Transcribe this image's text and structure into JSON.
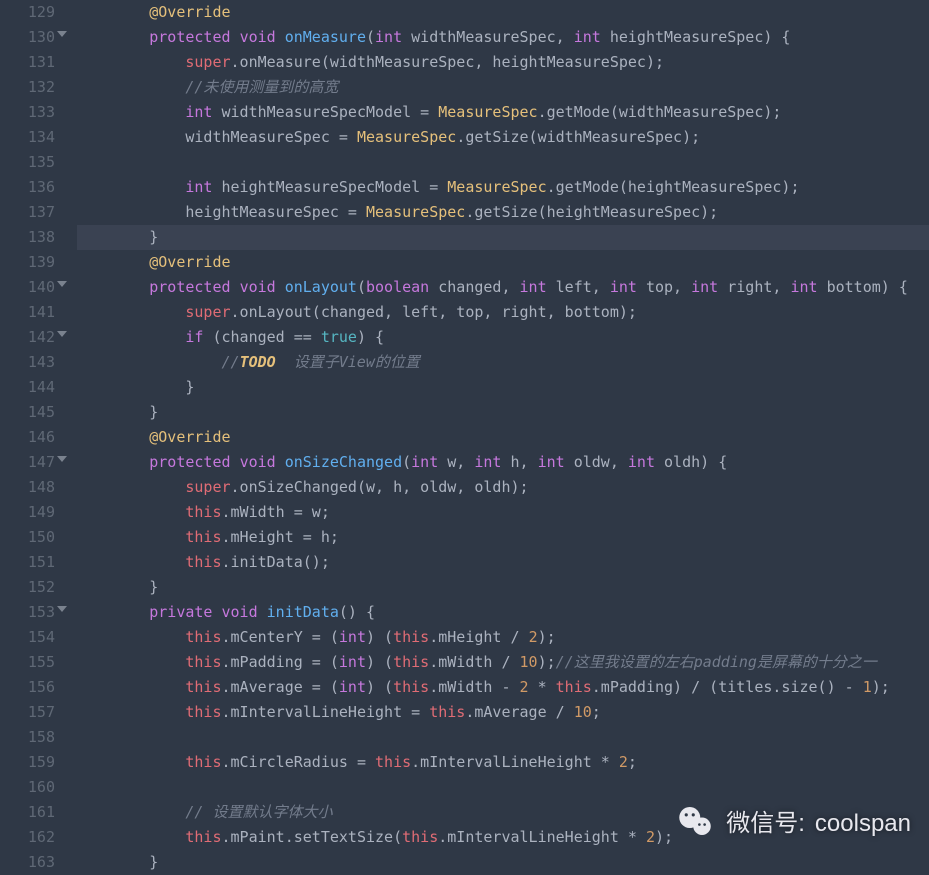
{
  "lines": [
    {
      "n": 129,
      "fold": false,
      "hl": false,
      "tokens": [
        [
          "pn",
          "        "
        ],
        [
          "ann",
          "@Override"
        ]
      ]
    },
    {
      "n": 130,
      "fold": true,
      "hl": false,
      "tokens": [
        [
          "pn",
          "        "
        ],
        [
          "kw",
          "protected"
        ],
        [
          "pn",
          " "
        ],
        [
          "kw",
          "void"
        ],
        [
          "pn",
          " "
        ],
        [
          "fn",
          "onMeasure"
        ],
        [
          "pn",
          "("
        ],
        [
          "kw",
          "int"
        ],
        [
          "pn",
          " widthMeasureSpec, "
        ],
        [
          "kw",
          "int"
        ],
        [
          "pn",
          " heightMeasureSpec) {"
        ]
      ]
    },
    {
      "n": 131,
      "fold": false,
      "hl": false,
      "tokens": [
        [
          "pn",
          "            "
        ],
        [
          "sup",
          "super"
        ],
        [
          "pn",
          ".onMeasure(widthMeasureSpec, heightMeasureSpec);"
        ]
      ]
    },
    {
      "n": 132,
      "fold": false,
      "hl": false,
      "tokens": [
        [
          "pn",
          "            "
        ],
        [
          "com",
          "//未使用测量到的高宽"
        ]
      ]
    },
    {
      "n": 133,
      "fold": false,
      "hl": false,
      "tokens": [
        [
          "pn",
          "            "
        ],
        [
          "kw",
          "int"
        ],
        [
          "pn",
          " widthMeasureSpecModel = "
        ],
        [
          "kw2",
          "MeasureSpec"
        ],
        [
          "pn",
          ".getMode(widthMeasureSpec);"
        ]
      ]
    },
    {
      "n": 134,
      "fold": false,
      "hl": false,
      "tokens": [
        [
          "pn",
          "            widthMeasureSpec = "
        ],
        [
          "kw2",
          "MeasureSpec"
        ],
        [
          "pn",
          ".getSize(widthMeasureSpec);"
        ]
      ]
    },
    {
      "n": 135,
      "fold": false,
      "hl": false,
      "tokens": [
        [
          "pn",
          ""
        ]
      ]
    },
    {
      "n": 136,
      "fold": false,
      "hl": false,
      "tokens": [
        [
          "pn",
          "            "
        ],
        [
          "kw",
          "int"
        ],
        [
          "pn",
          " heightMeasureSpecModel = "
        ],
        [
          "kw2",
          "MeasureSpec"
        ],
        [
          "pn",
          ".getMode(heightMeasureSpec);"
        ]
      ]
    },
    {
      "n": 137,
      "fold": false,
      "hl": false,
      "tokens": [
        [
          "pn",
          "            heightMeasureSpec = "
        ],
        [
          "kw2",
          "MeasureSpec"
        ],
        [
          "pn",
          ".getSize(heightMeasureSpec);"
        ]
      ]
    },
    {
      "n": 138,
      "fold": false,
      "hl": true,
      "tokens": [
        [
          "pn",
          "        }"
        ]
      ]
    },
    {
      "n": 139,
      "fold": false,
      "hl": false,
      "tokens": [
        [
          "pn",
          "        "
        ],
        [
          "ann",
          "@Override"
        ]
      ]
    },
    {
      "n": 140,
      "fold": true,
      "hl": false,
      "tokens": [
        [
          "pn",
          "        "
        ],
        [
          "kw",
          "protected"
        ],
        [
          "pn",
          " "
        ],
        [
          "kw",
          "void"
        ],
        [
          "pn",
          " "
        ],
        [
          "fn",
          "onLayout"
        ],
        [
          "pn",
          "("
        ],
        [
          "kw",
          "boolean"
        ],
        [
          "pn",
          " changed, "
        ],
        [
          "kw",
          "int"
        ],
        [
          "pn",
          " left, "
        ],
        [
          "kw",
          "int"
        ],
        [
          "pn",
          " top, "
        ],
        [
          "kw",
          "int"
        ],
        [
          "pn",
          " right, "
        ],
        [
          "kw",
          "int"
        ],
        [
          "pn",
          " bottom) {"
        ]
      ]
    },
    {
      "n": 141,
      "fold": false,
      "hl": false,
      "tokens": [
        [
          "pn",
          "            "
        ],
        [
          "sup",
          "super"
        ],
        [
          "pn",
          ".onLayout(changed, left, top, right, bottom);"
        ]
      ]
    },
    {
      "n": 142,
      "fold": true,
      "hl": false,
      "tokens": [
        [
          "pn",
          "            "
        ],
        [
          "kw",
          "if"
        ],
        [
          "pn",
          " (changed == "
        ],
        [
          "lit",
          "true"
        ],
        [
          "pn",
          ") {"
        ]
      ]
    },
    {
      "n": 143,
      "fold": false,
      "hl": false,
      "tokens": [
        [
          "pn",
          "                "
        ],
        [
          "com",
          "//"
        ],
        [
          "todo",
          "TODO"
        ],
        [
          "com",
          "  设置子View的位置"
        ]
      ]
    },
    {
      "n": 144,
      "fold": false,
      "hl": false,
      "tokens": [
        [
          "pn",
          "            }"
        ]
      ]
    },
    {
      "n": 145,
      "fold": false,
      "hl": false,
      "tokens": [
        [
          "pn",
          "        }"
        ]
      ]
    },
    {
      "n": 146,
      "fold": false,
      "hl": false,
      "tokens": [
        [
          "pn",
          "        "
        ],
        [
          "ann",
          "@Override"
        ]
      ]
    },
    {
      "n": 147,
      "fold": true,
      "hl": false,
      "tokens": [
        [
          "pn",
          "        "
        ],
        [
          "kw",
          "protected"
        ],
        [
          "pn",
          " "
        ],
        [
          "kw",
          "void"
        ],
        [
          "pn",
          " "
        ],
        [
          "fn",
          "onSizeChanged"
        ],
        [
          "pn",
          "("
        ],
        [
          "kw",
          "int"
        ],
        [
          "pn",
          " w, "
        ],
        [
          "kw",
          "int"
        ],
        [
          "pn",
          " h, "
        ],
        [
          "kw",
          "int"
        ],
        [
          "pn",
          " oldw, "
        ],
        [
          "kw",
          "int"
        ],
        [
          "pn",
          " oldh) {"
        ]
      ]
    },
    {
      "n": 148,
      "fold": false,
      "hl": false,
      "tokens": [
        [
          "pn",
          "            "
        ],
        [
          "sup",
          "super"
        ],
        [
          "pn",
          ".onSizeChanged(w, h, oldw, oldh);"
        ]
      ]
    },
    {
      "n": 149,
      "fold": false,
      "hl": false,
      "tokens": [
        [
          "pn",
          "            "
        ],
        [
          "sup",
          "this"
        ],
        [
          "pn",
          ".mWidth = w;"
        ]
      ]
    },
    {
      "n": 150,
      "fold": false,
      "hl": false,
      "tokens": [
        [
          "pn",
          "            "
        ],
        [
          "sup",
          "this"
        ],
        [
          "pn",
          ".mHeight = h;"
        ]
      ]
    },
    {
      "n": 151,
      "fold": false,
      "hl": false,
      "tokens": [
        [
          "pn",
          "            "
        ],
        [
          "sup",
          "this"
        ],
        [
          "pn",
          ".initData();"
        ]
      ]
    },
    {
      "n": 152,
      "fold": false,
      "hl": false,
      "tokens": [
        [
          "pn",
          "        }"
        ]
      ]
    },
    {
      "n": 153,
      "fold": true,
      "hl": false,
      "tokens": [
        [
          "pn",
          "        "
        ],
        [
          "kw",
          "private"
        ],
        [
          "pn",
          " "
        ],
        [
          "kw",
          "void"
        ],
        [
          "pn",
          " "
        ],
        [
          "fn",
          "initData"
        ],
        [
          "pn",
          "() {"
        ]
      ]
    },
    {
      "n": 154,
      "fold": false,
      "hl": false,
      "tokens": [
        [
          "pn",
          "            "
        ],
        [
          "sup",
          "this"
        ],
        [
          "pn",
          ".mCenterY = ("
        ],
        [
          "kw",
          "int"
        ],
        [
          "pn",
          ") ("
        ],
        [
          "sup",
          "this"
        ],
        [
          "pn",
          ".mHeight / "
        ],
        [
          "num",
          "2"
        ],
        [
          "pn",
          ");"
        ]
      ]
    },
    {
      "n": 155,
      "fold": false,
      "hl": false,
      "tokens": [
        [
          "pn",
          "            "
        ],
        [
          "sup",
          "this"
        ],
        [
          "pn",
          ".mPadding = ("
        ],
        [
          "kw",
          "int"
        ],
        [
          "pn",
          ") ("
        ],
        [
          "sup",
          "this"
        ],
        [
          "pn",
          ".mWidth / "
        ],
        [
          "num",
          "10"
        ],
        [
          "pn",
          ");"
        ],
        [
          "com",
          "//这里我设置的左右padding是屏幕的十分之一"
        ]
      ]
    },
    {
      "n": 156,
      "fold": false,
      "hl": false,
      "tokens": [
        [
          "pn",
          "            "
        ],
        [
          "sup",
          "this"
        ],
        [
          "pn",
          ".mAverage = ("
        ],
        [
          "kw",
          "int"
        ],
        [
          "pn",
          ") ("
        ],
        [
          "sup",
          "this"
        ],
        [
          "pn",
          ".mWidth - "
        ],
        [
          "num",
          "2"
        ],
        [
          "pn",
          " * "
        ],
        [
          "sup",
          "this"
        ],
        [
          "pn",
          ".mPadding) / (titles.size() - "
        ],
        [
          "num",
          "1"
        ],
        [
          "pn",
          ");"
        ]
      ]
    },
    {
      "n": 157,
      "fold": false,
      "hl": false,
      "tokens": [
        [
          "pn",
          "            "
        ],
        [
          "sup",
          "this"
        ],
        [
          "pn",
          ".mIntervalLineHeight = "
        ],
        [
          "sup",
          "this"
        ],
        [
          "pn",
          ".mAverage / "
        ],
        [
          "num",
          "10"
        ],
        [
          "pn",
          ";"
        ]
      ]
    },
    {
      "n": 158,
      "fold": false,
      "hl": false,
      "tokens": [
        [
          "pn",
          ""
        ]
      ]
    },
    {
      "n": 159,
      "fold": false,
      "hl": false,
      "tokens": [
        [
          "pn",
          "            "
        ],
        [
          "sup",
          "this"
        ],
        [
          "pn",
          ".mCircleRadius = "
        ],
        [
          "sup",
          "this"
        ],
        [
          "pn",
          ".mIntervalLineHeight * "
        ],
        [
          "num",
          "2"
        ],
        [
          "pn",
          ";"
        ]
      ]
    },
    {
      "n": 160,
      "fold": false,
      "hl": false,
      "tokens": [
        [
          "pn",
          ""
        ]
      ]
    },
    {
      "n": 161,
      "fold": false,
      "hl": false,
      "tokens": [
        [
          "pn",
          "            "
        ],
        [
          "com",
          "// 设置默认字体大小"
        ]
      ]
    },
    {
      "n": 162,
      "fold": false,
      "hl": false,
      "tokens": [
        [
          "pn",
          "            "
        ],
        [
          "sup",
          "this"
        ],
        [
          "pn",
          ".mPaint.setTextSize("
        ],
        [
          "sup",
          "this"
        ],
        [
          "pn",
          ".mIntervalLineHeight * "
        ],
        [
          "num",
          "2"
        ],
        [
          "pn",
          ");"
        ]
      ]
    },
    {
      "n": 163,
      "fold": false,
      "hl": false,
      "tokens": [
        [
          "pn",
          "        }"
        ]
      ]
    }
  ],
  "watermark": {
    "label": "微信号:",
    "value": "coolspan"
  }
}
